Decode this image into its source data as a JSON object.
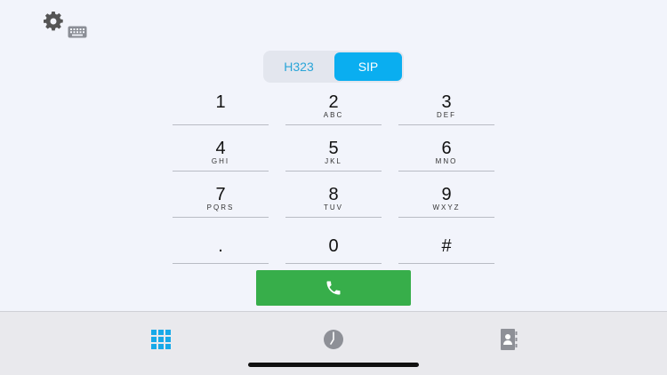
{
  "toolbar": {
    "settings_icon": "gear-icon",
    "keyboard_icon": "keyboard-icon"
  },
  "protocol": {
    "options": [
      "H323",
      "SIP"
    ],
    "selected": "SIP"
  },
  "keypad": {
    "keys": [
      {
        "digit": "1",
        "letters": ""
      },
      {
        "digit": "2",
        "letters": "ABC"
      },
      {
        "digit": "3",
        "letters": "DEF"
      },
      {
        "digit": "4",
        "letters": "GHI"
      },
      {
        "digit": "5",
        "letters": "JKL"
      },
      {
        "digit": "6",
        "letters": "MNO"
      },
      {
        "digit": "7",
        "letters": "PQRS"
      },
      {
        "digit": "8",
        "letters": "TUV"
      },
      {
        "digit": "9",
        "letters": "WXYZ"
      },
      {
        "digit": ".",
        "letters": ""
      },
      {
        "digit": "0",
        "letters": ""
      },
      {
        "digit": "#",
        "letters": ""
      }
    ]
  },
  "call_button": {
    "icon": "phone-icon"
  },
  "tabbar": {
    "tabs": [
      {
        "icon": "keypad-grid-icon",
        "active": true
      },
      {
        "icon": "clock-icon",
        "active": false
      },
      {
        "icon": "contacts-book-icon",
        "active": false
      }
    ]
  },
  "colors": {
    "accent": "#0aaef0",
    "call": "#37ae4a",
    "background": "#f2f4fb",
    "tabbar": "#e9e9ed"
  }
}
